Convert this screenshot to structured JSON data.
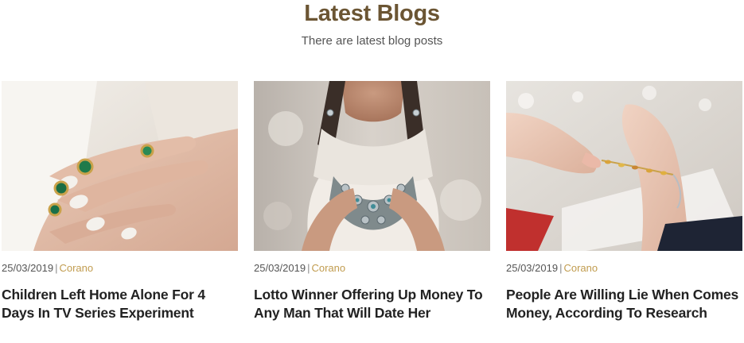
{
  "header": {
    "title": "Latest Blogs",
    "subtitle": "There are latest blog posts"
  },
  "posts": [
    {
      "image": "hand-with-emerald-rings-photo",
      "date": "25/03/2019",
      "author": "Corano",
      "title": "Children Left Home Alone For 4 Days In TV Series Experiment"
    },
    {
      "image": "woman-with-silver-necklace-photo",
      "date": "25/03/2019",
      "author": "Corano",
      "title": "Lotto Winner Offering Up Money To Any Man That Will Date Her"
    },
    {
      "image": "hands-with-bracelet-photo",
      "date": "25/03/2019",
      "author": "Corano",
      "title": "People Are Willing Lie When Comes Money, According To Research"
    }
  ],
  "colors": {
    "title": "#6b5533",
    "author_link": "#c19c4f",
    "post_title": "#222222",
    "meta_text": "#555555"
  }
}
